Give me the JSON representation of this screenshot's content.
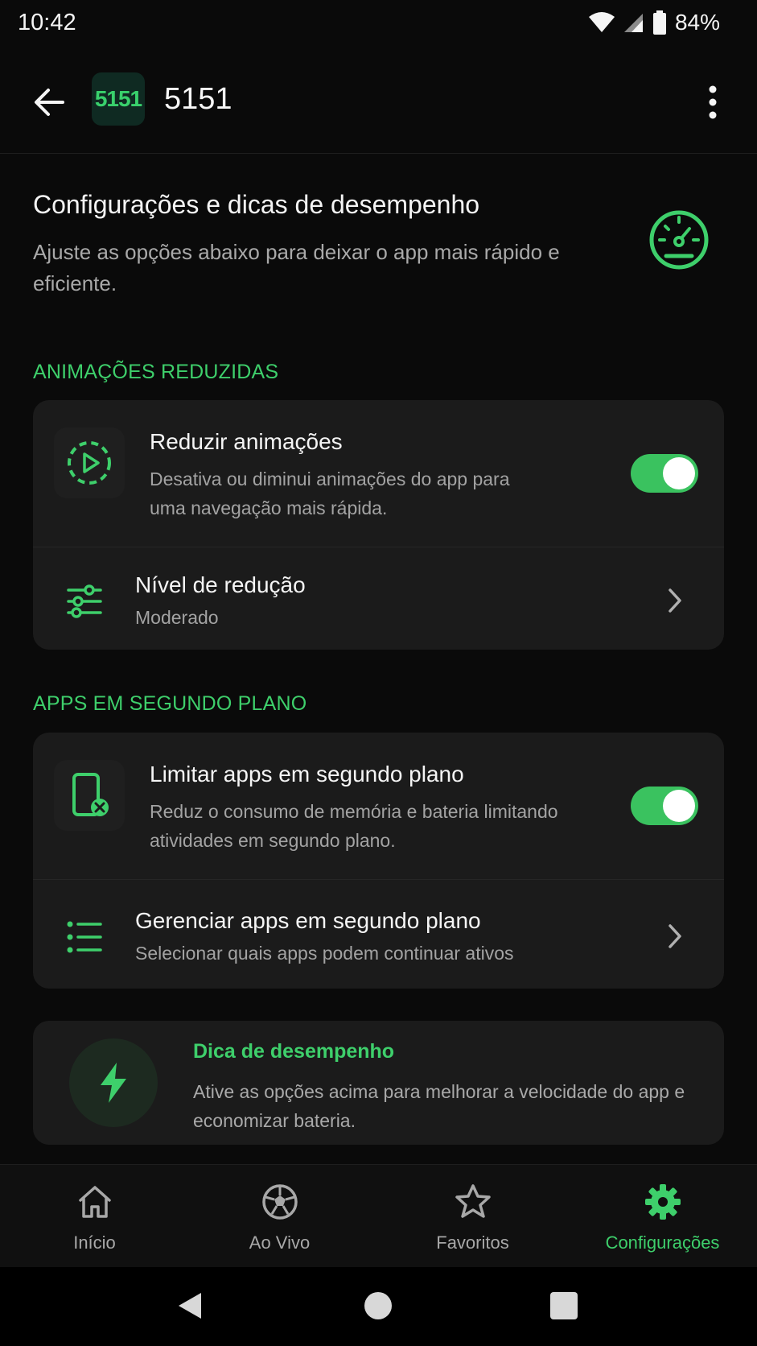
{
  "status_bar": {
    "time": "10:42",
    "battery": "84%"
  },
  "app_bar": {
    "logo_text": "5151",
    "title": "5151"
  },
  "intro": {
    "title": "Configurações e dicas de desempenho",
    "subtitle": "Ajuste as opções abaixo para deixar o app mais rápido e eficiente."
  },
  "section_animations": {
    "label": "ANIMAÇÕES REDUZIDAS",
    "reduce": {
      "title": "Reduzir animações",
      "description": "Desativa ou diminui animações do app para uma navegação mais rápida.",
      "enabled": true
    },
    "level": {
      "title": "Nível de redução",
      "value": "Moderado"
    }
  },
  "section_background": {
    "label": "APPS EM SEGUNDO PLANO",
    "limit": {
      "title": "Limitar apps em segundo plano",
      "description": "Reduz o consumo de memória e bateria limitando atividades em segundo plano.",
      "enabled": true
    },
    "manage": {
      "title": "Gerenciar apps em segundo plano",
      "subtitle": "Selecionar quais apps podem continuar ativos"
    }
  },
  "tip": {
    "title": "Dica de desempenho",
    "text": "Ative as opções acima para melhorar a velocidade do app e economizar bateria."
  },
  "bottom_nav": {
    "items": [
      {
        "label": "Início",
        "icon": "home-icon"
      },
      {
        "label": "Ao Vivo",
        "icon": "soccer-ball-icon"
      },
      {
        "label": "Favoritos",
        "icon": "star-icon"
      },
      {
        "label": "Configurações",
        "icon": "gear-icon",
        "active": true
      }
    ]
  },
  "colors": {
    "accent": "#3ecf6b",
    "background": "#0a0a0a",
    "card": "#1b1b1b"
  }
}
